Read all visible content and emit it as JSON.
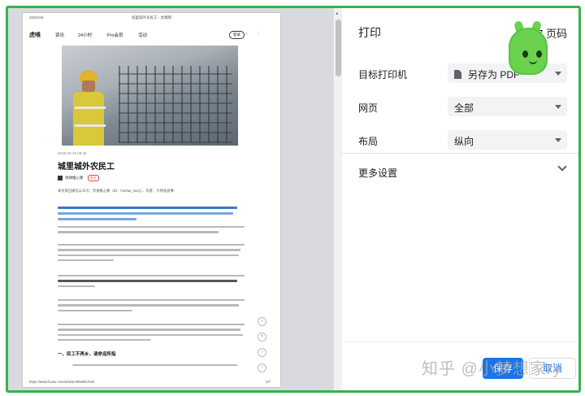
{
  "preview": {
    "header_date": "2020/4/6",
    "header_title": "城里城外农民工 - 虎嗅网",
    "nav": {
      "logo": "虎嗅",
      "items": [
        "资讯",
        "24小时",
        "Pro会员",
        "活动"
      ],
      "login": "登录"
    },
    "article": {
      "time": "2019-03-19 08:48",
      "title": "城里城外农民工",
      "author": "地球推心要",
      "author_tag": "关注",
      "source_line": "本文来自微信公众号：饮食推心要（ID：Fachai_story），作者：大师会说事",
      "section_heading": "一、民工不再乡，请命运所指"
    },
    "footer_url": "https://www.huxiu.com/article/289455.html",
    "footer_page": "1/7",
    "hero_colors": {
      "helmet": "#e3b12a",
      "vest": "#d8c83a"
    }
  },
  "panel": {
    "title": "打印",
    "page_count": "7 页码",
    "destination_label": "目标打印机",
    "destination_value": "另存为 PDF",
    "pages_label": "网页",
    "pages_value": "全部",
    "layout_label": "布局",
    "layout_value": "纵向",
    "more_settings": "更多设置",
    "save_button": "保存",
    "cancel_button": "取消",
    "watermark": "知乎 @小梦想家ry"
  },
  "colors": {
    "accent": "#1a73e8",
    "frame_border": "#35b44a",
    "mascot": "#6bd14f"
  }
}
